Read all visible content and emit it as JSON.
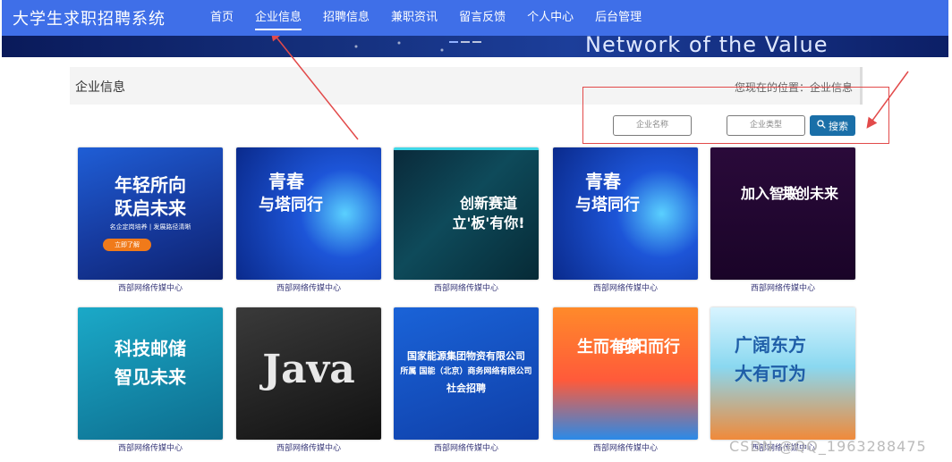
{
  "nav": {
    "brand": "大学生求职招聘系统",
    "items": [
      {
        "label": "首页"
      },
      {
        "label": "企业信息"
      },
      {
        "label": "招聘信息"
      },
      {
        "label": "兼职资讯"
      },
      {
        "label": "留言反馈"
      },
      {
        "label": "个人中心"
      },
      {
        "label": "后台管理"
      }
    ]
  },
  "hero": {
    "slogan": "Network of the Value"
  },
  "breadcrumb": {
    "title": "企业信息",
    "location": "您现在的位置：企业信息"
  },
  "search": {
    "name_placeholder": "企业名称",
    "type_placeholder": "企业类型",
    "button_label": "搜索"
  },
  "cards": [
    {
      "lines": [
        "年轻所向",
        "跃启未来"
      ],
      "sub": "名企定岗培养 | 发展路径清晰",
      "badge": "立即了解",
      "caption": "西部网络传媒中心"
    },
    {
      "lines": [
        "青春",
        "与塔同行"
      ],
      "sub": "",
      "badge": "",
      "caption": "西部网络传媒中心"
    },
    {
      "lines": [
        "创新赛道",
        "立'板'有你!"
      ],
      "sub": "",
      "badge": "",
      "caption": "西部网络传媒中心"
    },
    {
      "lines": [
        "青春",
        "与塔同行"
      ],
      "sub": "",
      "badge": "",
      "caption": "西部网络传媒中心"
    },
    {
      "lines": [
        "加入智联",
        "共创未来"
      ],
      "sub": "",
      "badge": "",
      "caption": "西部网络传媒中心"
    },
    {
      "lines": [
        "科技邮储",
        "智见未来"
      ],
      "sub": "",
      "badge": "",
      "caption": "西部网络传媒中心"
    },
    {
      "lines": [
        "Java"
      ],
      "sub": "",
      "badge": "",
      "caption": "西部网络传媒中心"
    },
    {
      "lines": [
        "国家能源集团物资有限公司",
        "所属 国能（北京）商务网络有限公司",
        "社会招聘"
      ],
      "sub": "",
      "badge": "",
      "caption": "西部网络传媒中心"
    },
    {
      "lines": [
        "生而有梦",
        "向阳而行"
      ],
      "sub": "",
      "badge": "",
      "caption": "西部网络传媒中心"
    },
    {
      "lines": [
        "广阔东方",
        "大有可为"
      ],
      "sub": "",
      "badge": "",
      "caption": "西部网络传媒中心"
    }
  ],
  "watermark": "CSDN @QQ_1963288475",
  "colors": {
    "nav_bg": "#3f6fe8",
    "search_btn": "#1a6fa8",
    "annotation": "#e24a4a"
  }
}
